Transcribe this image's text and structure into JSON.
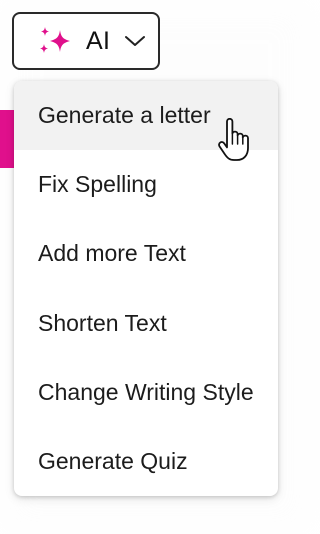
{
  "toolbar": {
    "ai_button": {
      "label": "AI",
      "icon": "sparkles-icon",
      "accent_color": "#e0108c"
    }
  },
  "menu": {
    "items": [
      {
        "label": "Generate a letter",
        "hovered": true
      },
      {
        "label": "Fix Spelling"
      },
      {
        "label": "Add more Text"
      },
      {
        "label": "Shorten Text"
      },
      {
        "label": "Change Writing Style"
      },
      {
        "label": "Generate Quiz"
      }
    ]
  },
  "cursor": {
    "type": "pointer-hand-icon"
  }
}
